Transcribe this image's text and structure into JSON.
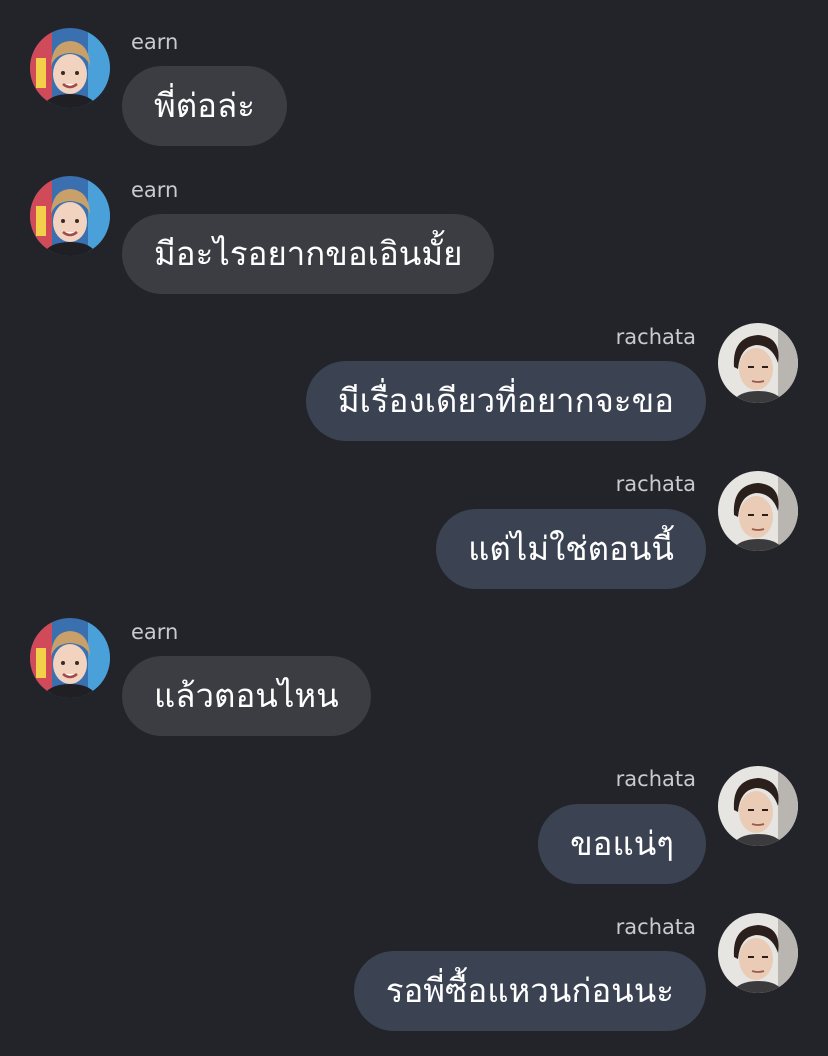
{
  "participants": {
    "earn": {
      "name": "earn",
      "avatar_icon": "user-photo-earn"
    },
    "rachata": {
      "name": "rachata",
      "avatar_icon": "user-photo-rachata"
    }
  },
  "messages": [
    {
      "sender": "earn",
      "side": "left",
      "text": "พี่ต่อล่ะ"
    },
    {
      "sender": "earn",
      "side": "left",
      "text": "มีอะไรอยากขอเอินมั้ย"
    },
    {
      "sender": "rachata",
      "side": "right",
      "text": "มีเรื่องเดียวที่อยากจะขอ"
    },
    {
      "sender": "rachata",
      "side": "right",
      "text": "แต่ไม่ใช่ตอนนี้"
    },
    {
      "sender": "earn",
      "side": "left",
      "text": "แล้วตอนไหน"
    },
    {
      "sender": "rachata",
      "side": "right",
      "text": "ขอแน่ๆ"
    },
    {
      "sender": "rachata",
      "side": "right",
      "text": "รอพี่ซื้อแหวนก่อนนะ"
    }
  ],
  "colors": {
    "background": "#232429",
    "incoming_bubble": "#3c3d42",
    "outgoing_bubble": "#3b4252",
    "name_text": "#c9cad0",
    "message_text": "#ffffff"
  }
}
